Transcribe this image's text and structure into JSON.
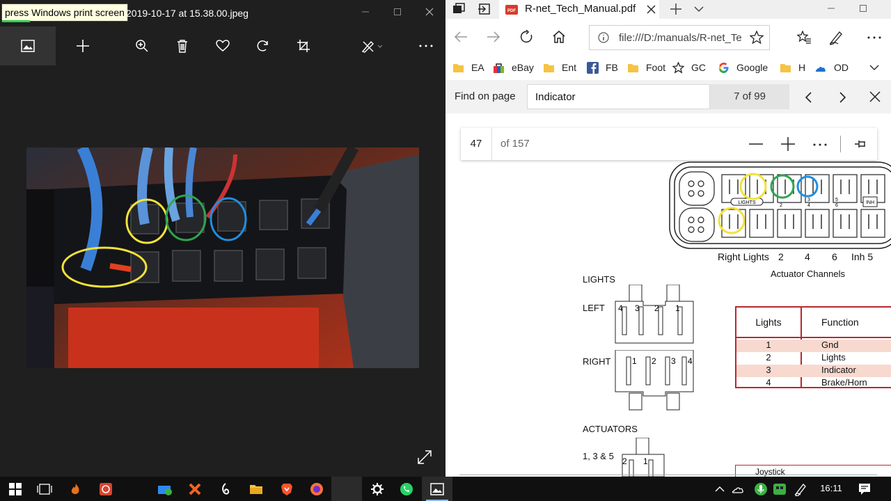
{
  "photos": {
    "tooltip": "press Windows print screen",
    "title": "2019-10-17 at 15.38.00.jpeg",
    "toolbar": [
      "view-photos",
      "add",
      "zoom",
      "delete",
      "favorite",
      "rotate",
      "crop",
      "edit-create",
      "more"
    ]
  },
  "edge": {
    "tab_title": "R-net_Tech_Manual.pdf",
    "address": "file:///D:/manuals/R-net_Te",
    "favorites": [
      "EA",
      "eBay",
      "Ent",
      "FB",
      "Foot",
      "GC",
      "Google",
      "H",
      "OD"
    ],
    "find": {
      "label": "Find on page",
      "query": "Indicator",
      "count": "7 of 99"
    },
    "pdf": {
      "page": "47",
      "of_pages": "of 157",
      "diagram": {
        "channel_labels": [
          "Right Lights",
          "2",
          "4",
          "6",
          "Inh 5"
        ],
        "actuator_channels": "Actuator Channels",
        "lights_badge": "LIGHTS",
        "inh_badge": "INH",
        "pin_nums": [
          "2",
          "4",
          "6",
          "3",
          "5"
        ]
      },
      "lights_heading": "LIGHTS",
      "left_label": "LEFT",
      "right_label": "RIGHT",
      "left_pins": [
        "4",
        "3",
        "2",
        "1"
      ],
      "right_pins": [
        "1",
        "2",
        "3",
        "4"
      ],
      "actuators_heading": "ACTUATORS",
      "actuators_sub": "1, 3 & 5",
      "actuator_pins": [
        "2",
        "1"
      ],
      "table": {
        "headers": [
          "Lights",
          "Function"
        ],
        "rows": [
          [
            "1",
            "Gnd"
          ],
          [
            "2",
            "Lights"
          ],
          [
            "3",
            "Indicator"
          ],
          [
            "4",
            "Brake/Horn"
          ]
        ]
      },
      "joystick": "Joystick"
    }
  },
  "taskbar": {
    "clock": "16:11"
  },
  "colors": {
    "highlight_yellow": "#f2e23a",
    "highlight_green": "#2fa44f",
    "highlight_blue": "#1f8fe0",
    "table_border": "#b8282e",
    "table_shade": "#f7d9cf"
  }
}
